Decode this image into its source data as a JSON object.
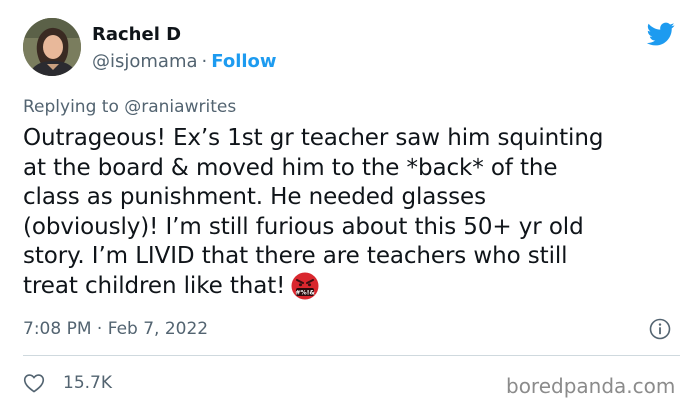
{
  "author": {
    "name": "Rachel D",
    "handle": "@isjomama",
    "separator": "·",
    "follow_label": "Follow"
  },
  "icons": {
    "brand": "twitter-bird-icon",
    "info": "info-icon",
    "like": "heart-icon",
    "emoji": "face-with-symbols-on-mouth-emoji"
  },
  "colors": {
    "accent": "#1d9bf0",
    "secondary_text": "#536471",
    "primary_text": "#0f1419",
    "emoji_red": "#d9272e"
  },
  "reply": {
    "prefix": "Replying to",
    "mention": "@raniawrites"
  },
  "tweet": {
    "lines": [
      "Outrageous! Ex’s 1st gr teacher saw him squinting",
      "at the board & moved him to the *back* of the",
      "class as punishment. He needed glasses",
      "(obviously)! I’m still furious about this 50+ yr old",
      "story. I’m LIVID that there are teachers who still",
      "treat children like that!"
    ],
    "emoji_text": "#%!&",
    "time": "7:08 PM",
    "date": "Feb 7, 2022",
    "separator": "·"
  },
  "stats": {
    "likes": "15.7K"
  },
  "watermark": "boredpanda.com"
}
